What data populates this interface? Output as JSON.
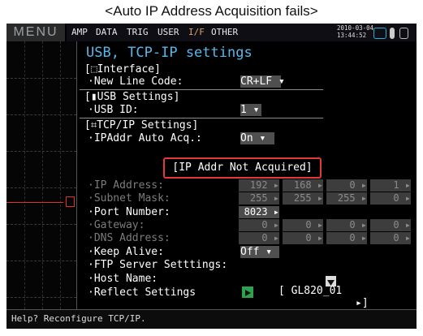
{
  "caption": "<Auto IP Address Acquisition fails>",
  "menu_label": "MENU",
  "tabs": [
    "AMP",
    "DATA",
    "TRIG",
    "USER",
    "I/F",
    "OTHER"
  ],
  "active_tab": "I/F",
  "date": "2010-03-04",
  "time": "13:44:52",
  "title": "USB, TCP-IP settings",
  "interface": {
    "header": "[⬚Interface]",
    "new_line_code_label": "·New Line Code:",
    "new_line_code_value": "CR+LF ▾"
  },
  "usb": {
    "header": "[▮USB Settings]",
    "usb_id_label": "·USB ID:",
    "usb_id_value": "1 ▾"
  },
  "tcpip": {
    "header": "[⌗TCP/IP Settings]",
    "ip_auto_label": "·IPAddr Auto Acq.:",
    "ip_auto_value": "On ▾",
    "status_message": "[IP Addr Not Acquired]",
    "ip_address_label": "·IP Address:",
    "ip_address": [
      "192 ▸",
      "168 ▸",
      "0 ▸",
      "1 ▸"
    ],
    "subnet_label": "·Subnet Mask:",
    "subnet": [
      "255 ▸",
      "255 ▸",
      "255 ▸",
      "0 ▸"
    ],
    "port_label": "·Port Number:",
    "port_value": "8023 ▸",
    "gateway_label": "·Gateway:",
    "gateway": [
      "0 ▸",
      "0 ▸",
      "0 ▸",
      "0 ▸"
    ],
    "dns_label": "·DNS Address:",
    "dns": [
      "0 ▸",
      "0 ▸",
      "0 ▸",
      "0 ▸"
    ],
    "keep_alive_label": "·Keep Alive:",
    "keep_alive_value": "Off ▾",
    "ftp_label": "·FTP Server Setttings:",
    "host_label": "·Host Name:",
    "host_value": "[ GL820_01",
    "host_end": "▸]",
    "reflect_label": "·Reflect Settings"
  },
  "help_text": "Help? Reconfigure TCP/IP.",
  "colors": {
    "title": "#59b8ea",
    "active_tab": "#d8a46a",
    "callout": "#e53935",
    "trace": "#e0302a",
    "reflect": "#2da24b"
  }
}
